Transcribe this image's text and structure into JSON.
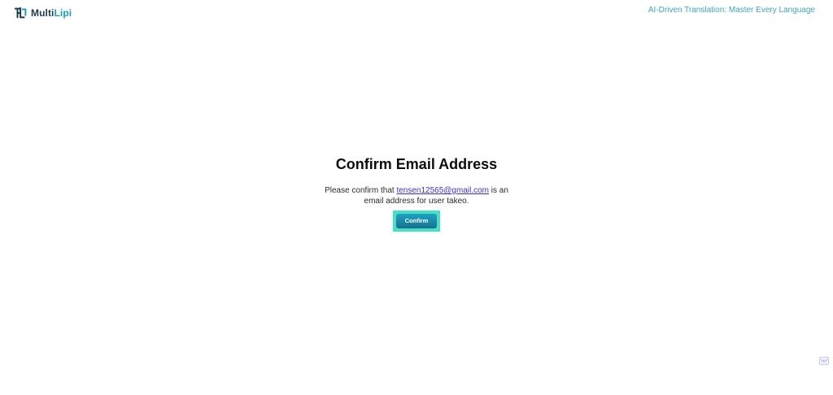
{
  "header": {
    "brand": {
      "part1": "Multi",
      "part2": "Lipi",
      "icon": "multilipi-logo-icon"
    },
    "tagline": "AI-Driven Translation: Master Every Language"
  },
  "main": {
    "title": "Confirm Email Address",
    "message": {
      "prefix": "Please confirm that ",
      "email": "tensen12565@gmail.com",
      "suffix": " is an email address for user takeo."
    },
    "confirm_label": "Confirm"
  },
  "floating": {
    "icon": "chat-widget-icon"
  },
  "colors": {
    "brand_dark": "#1f3a4d",
    "brand_accent": "#1aa0b4",
    "tagline": "#3aa9b9",
    "link": "#3a2fd6",
    "button_start": "#1ba3c4",
    "button_end": "#176f8e",
    "button_focus": "#48e0c2"
  }
}
